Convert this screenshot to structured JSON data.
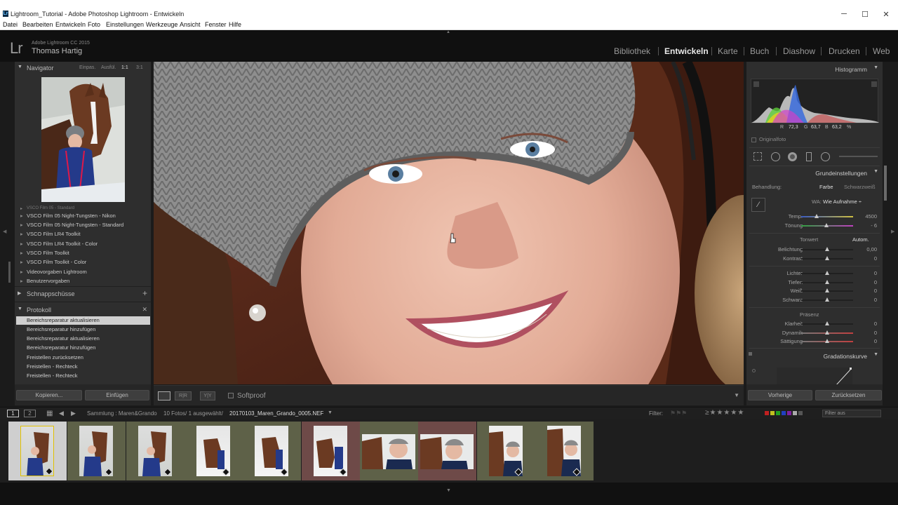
{
  "window": {
    "title": "Lightroom_Tutorial - Adobe Photoshop Lightroom - Entwickeln",
    "icon": "lr-app-icon",
    "controls": {
      "minimize": "─",
      "maximize": "☐",
      "close": "✕"
    }
  },
  "menu": [
    "Datei",
    "Bearbeiten",
    "Entwickeln",
    "Foto",
    "Einstellungen",
    "Werkzeuge",
    "Ansicht",
    "Fenster",
    "Hilfe"
  ],
  "identity": {
    "logo": "Lr",
    "product": "Adobe Lightroom CC 2015",
    "user": "Thomas Hartig"
  },
  "modules": [
    {
      "label": "Bibliothek",
      "active": false
    },
    {
      "label": "Entwickeln",
      "active": true
    },
    {
      "label": "Karte",
      "active": false
    },
    {
      "label": "Buch",
      "active": false
    },
    {
      "label": "Diashow",
      "active": false
    },
    {
      "label": "Drucken",
      "active": false
    },
    {
      "label": "Web",
      "active": false
    }
  ],
  "navigator": {
    "title": "Navigator",
    "zoom": [
      "Einpas.",
      "Ausfül.",
      "1:1",
      "3:1"
    ]
  },
  "presets": [
    "VSCO Film 05 Night-Tungsten - Nikon",
    "VSCO Film 05 Night-Tungsten - Standard",
    "VSCO Film LR4 Toolkit",
    "VSCO Film LR4 Toolkit - Color",
    "VSCO Film Toolkit",
    "VSCO Film Toolkit - Color",
    "Videovorgaben Lightroom",
    "Benutzervorgaben"
  ],
  "snapshots": {
    "title": "Schnappschüsse",
    "add": "+"
  },
  "history": {
    "title": "Protokoll",
    "clear": "✕",
    "items": [
      "Bereichsreparatur aktualisieren",
      "Bereichsreparatur hinzufügen",
      "Bereichsreparatur aktualisieren",
      "Bereichsreparatur hinzufügen",
      "Freistellen zurücksetzen",
      "Freistellen - Rechteck",
      "Freistellen - Rechteck"
    ]
  },
  "left_buttons": {
    "copy": "Kopieren...",
    "paste": "Einfügen"
  },
  "toolbar": {
    "softproof": "Softproof"
  },
  "histogram": {
    "title": "Histogramm",
    "r_label": "R",
    "r": "72,3",
    "g_label": "G",
    "g": "63,7",
    "b_label": "B",
    "b": "63,2",
    "unit": "%",
    "original": "Originalfoto"
  },
  "basic": {
    "title": "Grundeinstellungen",
    "treatment_label": "Behandlung:",
    "color": "Farbe",
    "bw": "Schwarzweiß",
    "wb_label": "WA:",
    "wb_value": "Wie Aufnahme ÷",
    "temp": {
      "label": "Temp.",
      "value": "4500",
      "pos": 0.3
    },
    "tint": {
      "label": "Tönung",
      "value": "- 6",
      "pos": 0.48
    },
    "tone_title": "Tonwert",
    "auto": "Autom.",
    "tone": [
      {
        "label": "Belichtung",
        "value": "0,00",
        "pos": 0.5
      },
      {
        "label": "Kontrast",
        "value": "0",
        "pos": 0.5
      }
    ],
    "tone2": [
      {
        "label": "Lichter",
        "value": "0",
        "pos": 0.5
      },
      {
        "label": "Tiefen",
        "value": "0",
        "pos": 0.5
      },
      {
        "label": "Weiß",
        "value": "0",
        "pos": 0.5
      },
      {
        "label": "Schwarz",
        "value": "0",
        "pos": 0.5
      }
    ],
    "presence_title": "Präsenz",
    "presence": [
      {
        "label": "Klarheit",
        "value": "0",
        "pos": 0.5
      },
      {
        "label": "Dynamik",
        "value": "0",
        "pos": 0.5
      },
      {
        "label": "Sättigung",
        "value": "0",
        "pos": 0.5
      }
    ]
  },
  "curve": {
    "title": "Gradationskurve"
  },
  "right_buttons": {
    "previous": "Vorherige",
    "reset": "Zurücksetzen"
  },
  "filmbar": {
    "page1": "1",
    "page2": "2",
    "source": "Sammlung : Maren&Grando",
    "count": "10 Fotos/ 1 ausgewählt/",
    "filename": "20170103_Maren_Grando_0005.NEF",
    "filter_label": "Filter:",
    "filter_value": "Filter aus"
  },
  "film_count": 10
}
